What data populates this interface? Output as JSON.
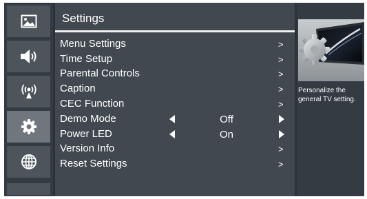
{
  "sidebar": {
    "items": [
      {
        "icon": "picture-icon",
        "active": false
      },
      {
        "icon": "sound-icon",
        "active": false
      },
      {
        "icon": "broadcast-icon",
        "active": false
      },
      {
        "icon": "gear-icon",
        "active": true
      },
      {
        "icon": "globe-icon",
        "active": false
      }
    ]
  },
  "main": {
    "title": "Settings",
    "menu": [
      {
        "label": "Menu Settings",
        "arrow": ">"
      },
      {
        "label": "Time Setup",
        "arrow": ">"
      },
      {
        "label": "Parental Controls",
        "arrow": ">"
      },
      {
        "label": "Caption",
        "arrow": ">"
      },
      {
        "label": "CEC Function",
        "arrow": ">"
      },
      {
        "label": "Demo Mode",
        "value": "Off"
      },
      {
        "label": "Power LED",
        "value": "On"
      },
      {
        "label": "Version Info",
        "arrow": ">"
      },
      {
        "label": "Reset Settings",
        "arrow": ">"
      }
    ]
  },
  "info": {
    "image": "tv-with-gear-illustration",
    "description": "Personalize the general TV setting."
  },
  "colors": {
    "background": "#2b3238",
    "sidebar_item": "#4d545b",
    "sidebar_active": "#6f767d",
    "main_panel": "#41484f",
    "text": "#ffffff"
  }
}
